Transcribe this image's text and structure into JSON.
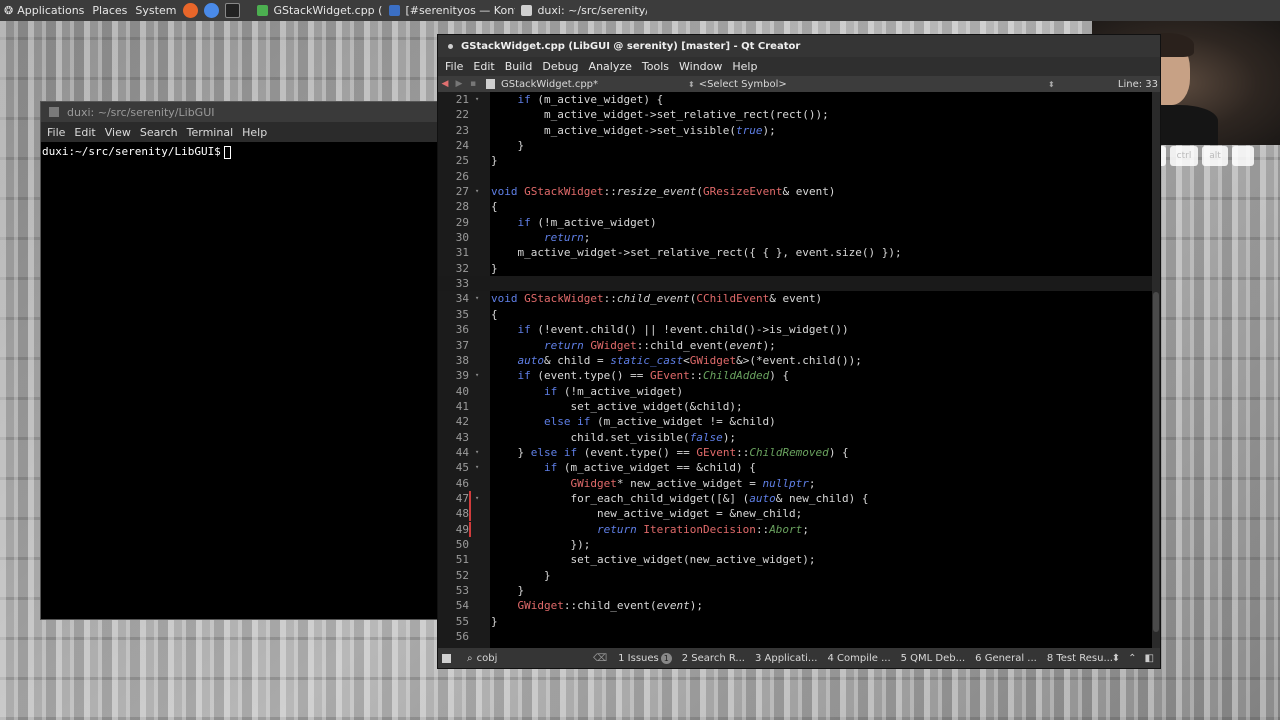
{
  "top_panel": {
    "applications": "Applications",
    "places": "Places",
    "system": "System",
    "launchers": [
      {
        "icon": "firefox-icon",
        "color": "#e8662a"
      },
      {
        "icon": "chromium-icon",
        "color": "#4a8ae8"
      },
      {
        "icon": "terminal-launcher-icon",
        "color": "#222222"
      }
    ],
    "tasks": [
      {
        "label": "GStackWidget.cpp (Lib...",
        "icon_color": "#4caf50"
      },
      {
        "label": "[#serenityos — Konvers...",
        "icon_color": "#3b6fc4"
      },
      {
        "label": "duxi: ~/src/serenity/Li...",
        "icon_color": "#d0d0d0"
      }
    ]
  },
  "webcam_keys": [
    "",
    "shift",
    "ctrl",
    "alt",
    ""
  ],
  "terminal": {
    "title": "duxi: ~/src/serenity/LibGUI",
    "menu": [
      "File",
      "Edit",
      "View",
      "Search",
      "Terminal",
      "Help"
    ],
    "prompt": "duxi:~/src/serenity/LibGUI$"
  },
  "qtcreator": {
    "title": "GStackWidget.cpp (LibGUI @ serenity) [master] - Qt Creator",
    "menu": [
      "File",
      "Edit",
      "Build",
      "Debug",
      "Analyze",
      "Tools",
      "Window",
      "Help"
    ],
    "doc_name": "GStackWidget.cpp*",
    "symbol": "<Select Symbol>",
    "line_indicator": "Line: 33",
    "code": [
      {
        "n": "21",
        "fold": "▾",
        "html": "    <span class=\"kw\">if</span> (m_active_widget) {"
      },
      {
        "n": "22",
        "fold": "",
        "html": "        m_active_widget-&gt;set_relative_rect(rect());"
      },
      {
        "n": "23",
        "fold": "",
        "html": "        m_active_widget-&gt;set_visible(<span class=\"kw\" style=\"font-style:italic\">true</span>);"
      },
      {
        "n": "24",
        "fold": "",
        "html": "    }"
      },
      {
        "n": "25",
        "fold": "",
        "html": "}"
      },
      {
        "n": "26",
        "fold": "",
        "html": ""
      },
      {
        "n": "27",
        "fold": "▾",
        "html": "<span class=\"kw\">void</span> <span class=\"ty\">GStackWidget</span>::<span class=\"fn\">resize_event</span>(<span class=\"ty\">GResizeEvent</span>&amp; event)"
      },
      {
        "n": "28",
        "fold": "",
        "html": "{"
      },
      {
        "n": "29",
        "fold": "",
        "html": "    <span class=\"kw\">if</span> (!m_active_widget)"
      },
      {
        "n": "30",
        "fold": "",
        "html": "        <span class=\"kw\" style=\"font-style:italic\">return</span>;"
      },
      {
        "n": "31",
        "fold": "",
        "html": "    m_active_widget-&gt;set_relative_rect({ { }, event.size() });"
      },
      {
        "n": "32",
        "fold": "",
        "html": "}"
      },
      {
        "n": "33",
        "fold": "",
        "html": "",
        "current": true
      },
      {
        "n": "34",
        "fold": "▾",
        "html": "<span class=\"kw\">void</span> <span class=\"ty\">GStackWidget</span>::<span class=\"fn\">child_event</span>(<span class=\"ty\">CChildEvent</span>&amp; event)"
      },
      {
        "n": "35",
        "fold": "",
        "html": "{"
      },
      {
        "n": "36",
        "fold": "",
        "html": "    <span class=\"kw\">if</span> (!event.child() || !event.child()-&gt;is_widget())"
      },
      {
        "n": "37",
        "fold": "",
        "html": "        <span class=\"kw\" style=\"font-style:italic\">return</span> <span class=\"ty\">GWidget</span>::child_event(<span class=\"pa\">event</span>);"
      },
      {
        "n": "38",
        "fold": "",
        "html": "    <span class=\"kw\" style=\"font-style:italic\">auto</span>&amp; child = <span class=\"kw\" style=\"font-style:italic\">static_cast</span>&lt;<span class=\"ty\">GWidget</span>&amp;&gt;(*event.child());"
      },
      {
        "n": "39",
        "fold": "▾",
        "html": "    <span class=\"kw\">if</span> (event.type() == <span class=\"ty\">GEvent</span>::<span class=\"en\">ChildAdded</span>) {"
      },
      {
        "n": "40",
        "fold": "",
        "html": "        <span class=\"kw\">if</span> (!m_active_widget)"
      },
      {
        "n": "41",
        "fold": "",
        "html": "            set_active_widget(&amp;child);"
      },
      {
        "n": "42",
        "fold": "",
        "html": "        <span class=\"kw\">else if</span> (m_active_widget != &amp;child)"
      },
      {
        "n": "43",
        "fold": "",
        "html": "            child.set_visible(<span class=\"kw\" style=\"font-style:italic\">false</span>);"
      },
      {
        "n": "44",
        "fold": "▾",
        "html": "    } <span class=\"kw\">else if</span> (event.type() == <span class=\"ty\">GEvent</span>::<span class=\"en\">ChildRemoved</span>) {"
      },
      {
        "n": "45",
        "fold": "▾",
        "html": "        <span class=\"kw\">if</span> (m_active_widget == &amp;child) {"
      },
      {
        "n": "46",
        "fold": "",
        "html": "            <span class=\"ty\">GWidget</span>* new_active_widget = <span class=\"kw\" style=\"font-style:italic\">nullptr</span>;"
      },
      {
        "n": "47",
        "fold": "▾",
        "html": "            for_each_child_widget([&amp;] (<span class=\"kw\" style=\"font-style:italic\">auto</span>&amp; new_child) {",
        "changed": true
      },
      {
        "n": "48",
        "fold": "",
        "html": "                new_active_widget = &amp;new_child;",
        "changed": true
      },
      {
        "n": "49",
        "fold": "",
        "html": "                <span class=\"kw\" style=\"font-style:italic\">return</span> <span class=\"ty\">IterationDecision</span>::<span class=\"en\">Abort</span>;",
        "changed": true
      },
      {
        "n": "50",
        "fold": "",
        "html": "            });"
      },
      {
        "n": "51",
        "fold": "",
        "html": "            set_active_widget(new_active_widget);"
      },
      {
        "n": "52",
        "fold": "",
        "html": "        }"
      },
      {
        "n": "53",
        "fold": "",
        "html": "    }"
      },
      {
        "n": "54",
        "fold": "",
        "html": "    <span class=\"ty\">GWidget</span>::child_event(<span class=\"pa\">event</span>);"
      },
      {
        "n": "55",
        "fold": "",
        "html": "}"
      },
      {
        "n": "56",
        "fold": "",
        "html": ""
      }
    ],
    "status": {
      "search_value": "cobj",
      "panes": [
        {
          "label": "1 Issues",
          "badge": "1"
        },
        {
          "label": "2 Search R..."
        },
        {
          "label": "3 Applicati..."
        },
        {
          "label": "4 Compile ..."
        },
        {
          "label": "5 QML Deb..."
        },
        {
          "label": "6 General ..."
        },
        {
          "label": "8 Test Resu..."
        }
      ]
    }
  }
}
